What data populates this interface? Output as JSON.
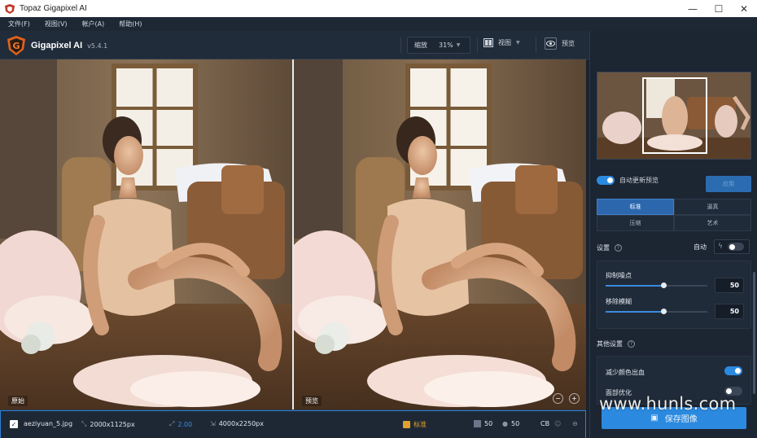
{
  "window": {
    "title": "Topaz Gigapixel AI",
    "controls": {
      "minimize": "—",
      "maximize": "☐",
      "close": "✕"
    }
  },
  "menu": [
    "文件(F)",
    "视图(V)",
    "帐户(A)",
    "帮助(H)"
  ],
  "app": {
    "name": "Gigapixel AI",
    "version": "v5.4.1"
  },
  "toolbar": {
    "zoom_label": "缩放",
    "zoom_value": "31%",
    "view_label": "视图",
    "preview_label": "预览"
  },
  "canvas": {
    "left_label": "原始",
    "right_label": "预览"
  },
  "statusbar": {
    "filename": "aeziyuan_5.jpg",
    "src_size": "2000x1125px",
    "scale": "2.00",
    "out_size": "4000x2250px",
    "mode": "标准",
    "noise": "50",
    "blur": "50",
    "cb": "CB"
  },
  "panel": {
    "auto_update_label": "自动更新预览",
    "apply_label": "应用",
    "modes": [
      "标准",
      "逼真",
      "压缩",
      "艺术"
    ],
    "settings_label": "设置",
    "auto_label": "自动",
    "suppress_noise_label": "抑制噪点",
    "suppress_noise_value": "50",
    "remove_blur_label": "移除模糊",
    "remove_blur_value": "50",
    "other_settings_label": "其他设置",
    "reduce_color_bleed_label": "减少颜色出血",
    "face_refine_label": "面部优化",
    "save_label": "保存图像",
    "auto_update_on": true,
    "auto_on": false,
    "reduce_color_bleed_on": true,
    "face_refine_on": false,
    "noise_level": 0.5,
    "blur_level": 0.5
  },
  "watermark": "www.hunls.com",
  "colors": {
    "accent": "#2b8ae0",
    "toolbar_bg": "#212c3a",
    "panel_bg": "#1c2532"
  },
  "icons": [
    "gigapixel-logo-icon",
    "view-split-icon",
    "eye-icon",
    "help-icon",
    "lightning-icon",
    "save-icon",
    "resize-icon",
    "export-icon",
    "standard-mode-icon"
  ]
}
